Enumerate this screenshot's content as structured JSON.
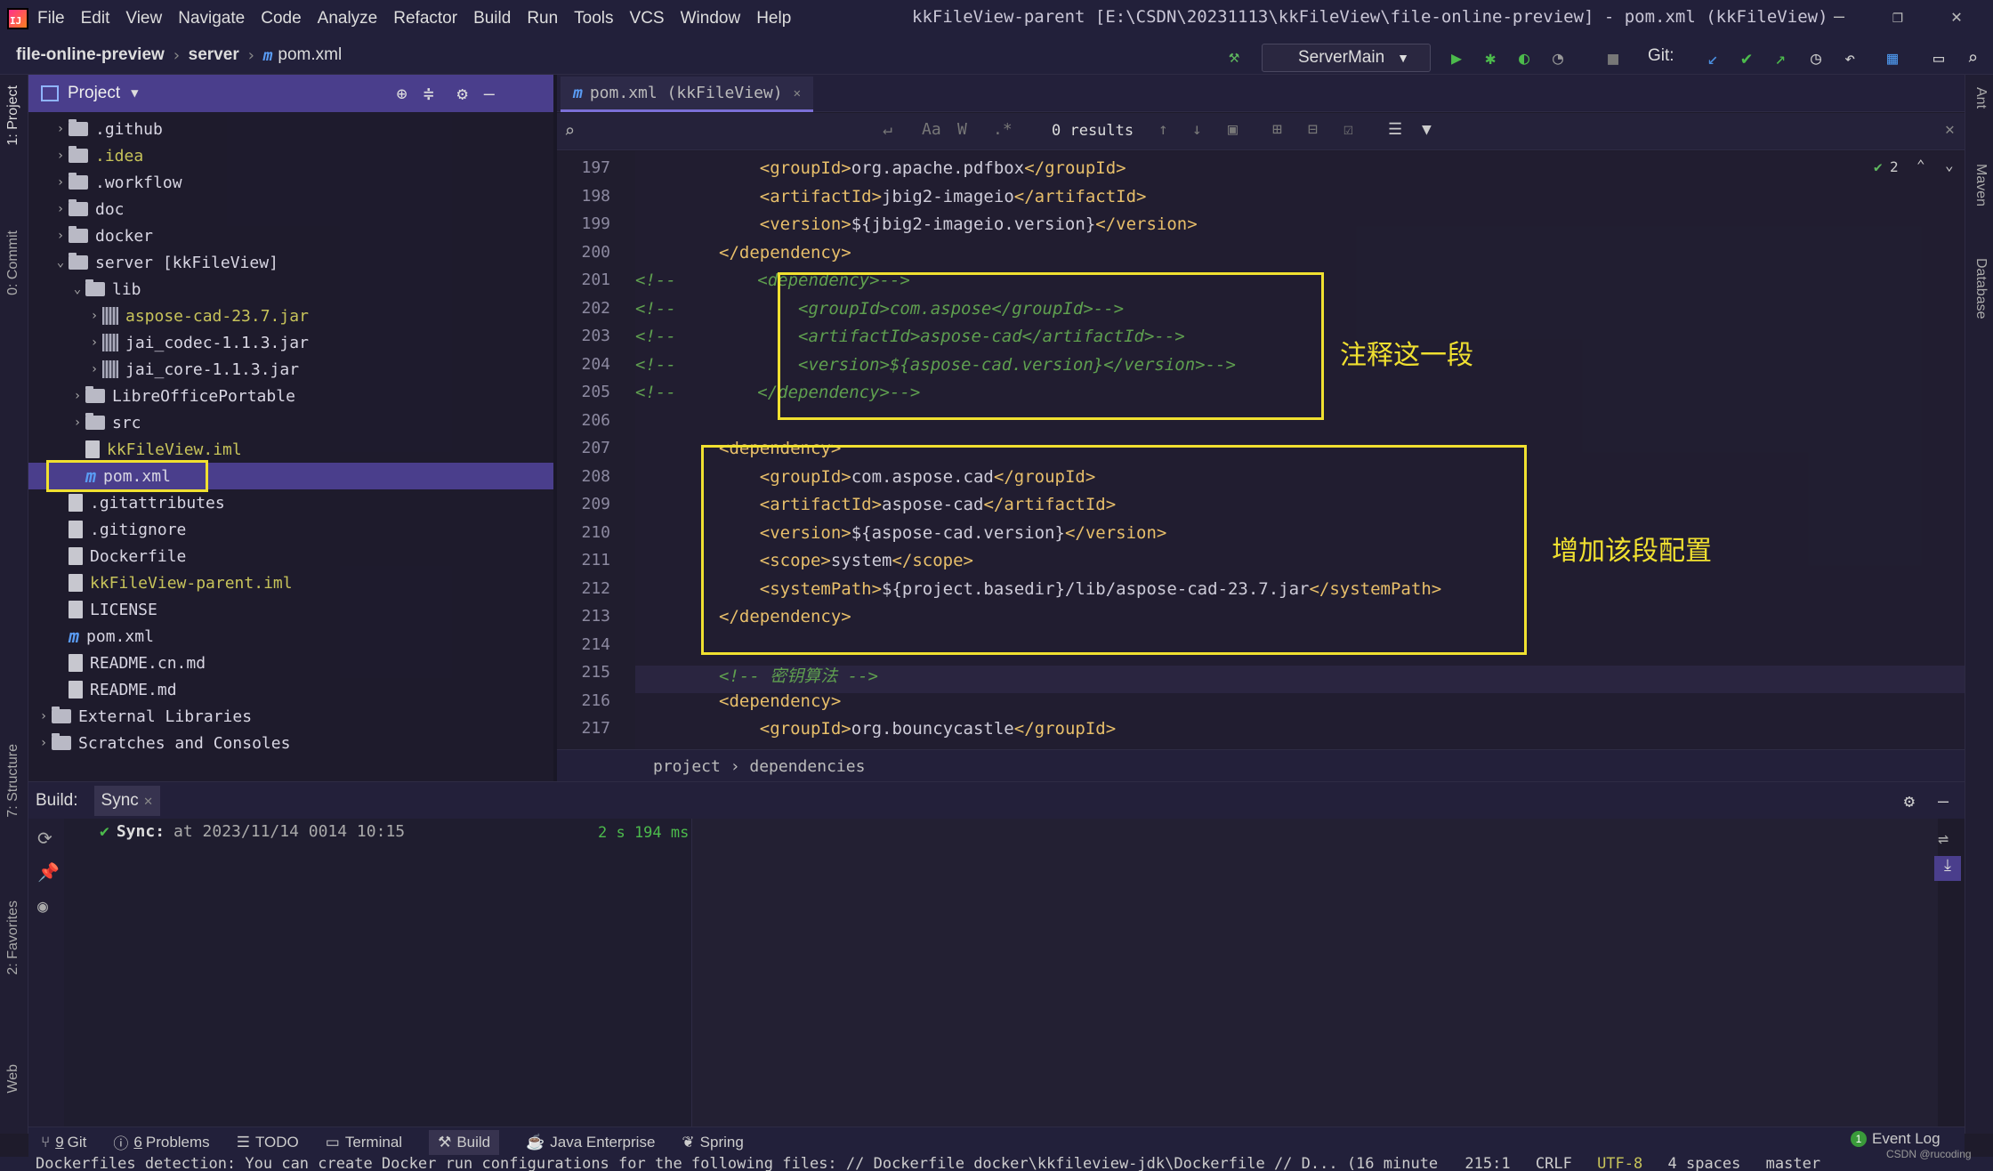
{
  "app": {
    "title": "kkFileView-parent [E:\\CSDN\\20231113\\kkFileView\\file-online-preview] - pom.xml (kkFileView)"
  },
  "menu": [
    "File",
    "Edit",
    "View",
    "Navigate",
    "Code",
    "Analyze",
    "Refactor",
    "Build",
    "Run",
    "Tools",
    "VCS",
    "Window",
    "Help"
  ],
  "breadcrumb": {
    "root": "file-online-preview",
    "module": "server",
    "file": "pom.xml"
  },
  "run_config": "ServerMain",
  "git_label": "Git:",
  "project_panel": {
    "title": "Project"
  },
  "tree": [
    {
      "name": ".github",
      "type": "folder",
      "depth": 1,
      "arrow": "›"
    },
    {
      "name": ".idea",
      "type": "folder",
      "depth": 1,
      "arrow": "›",
      "excluded": true
    },
    {
      "name": ".workflow",
      "type": "folder",
      "depth": 1,
      "arrow": "›"
    },
    {
      "name": "doc",
      "type": "folder",
      "depth": 1,
      "arrow": "›"
    },
    {
      "name": "docker",
      "type": "folder",
      "depth": 1,
      "arrow": "›"
    },
    {
      "name": "server [kkFileView]",
      "type": "folder",
      "depth": 1,
      "arrow": "⌄"
    },
    {
      "name": "lib",
      "type": "folder",
      "depth": 2,
      "arrow": "⌄"
    },
    {
      "name": "aspose-cad-23.7.jar",
      "type": "jar",
      "depth": 3,
      "arrow": "›",
      "excluded": true
    },
    {
      "name": "jai_codec-1.1.3.jar",
      "type": "jar",
      "depth": 3,
      "arrow": "›"
    },
    {
      "name": "jai_core-1.1.3.jar",
      "type": "jar",
      "depth": 3,
      "arrow": "›"
    },
    {
      "name": "LibreOfficePortable",
      "type": "folder",
      "depth": 2,
      "arrow": "›"
    },
    {
      "name": "src",
      "type": "folder",
      "depth": 2,
      "arrow": "›"
    },
    {
      "name": "kkFileView.iml",
      "type": "file",
      "depth": 2,
      "arrow": "",
      "excluded": true
    },
    {
      "name": "pom.xml",
      "type": "maven",
      "depth": 2,
      "arrow": "",
      "selected": true
    },
    {
      "name": ".gitattributes",
      "type": "file",
      "depth": 1,
      "arrow": ""
    },
    {
      "name": ".gitignore",
      "type": "file",
      "depth": 1,
      "arrow": ""
    },
    {
      "name": "Dockerfile",
      "type": "file",
      "depth": 1,
      "arrow": ""
    },
    {
      "name": "kkFileView-parent.iml",
      "type": "file",
      "depth": 1,
      "arrow": "",
      "excluded": true
    },
    {
      "name": "LICENSE",
      "type": "file",
      "depth": 1,
      "arrow": ""
    },
    {
      "name": "pom.xml",
      "type": "maven",
      "depth": 1,
      "arrow": ""
    },
    {
      "name": "README.cn.md",
      "type": "file",
      "depth": 1,
      "arrow": ""
    },
    {
      "name": "README.md",
      "type": "file",
      "depth": 1,
      "arrow": ""
    },
    {
      "name": "External Libraries",
      "type": "lib",
      "depth": 0,
      "arrow": "›"
    },
    {
      "name": "Scratches and Consoles",
      "type": "scratch",
      "depth": 0,
      "arrow": "›"
    }
  ],
  "editor_tab": "pom.xml (kkFileView)",
  "search": {
    "results": "0 results"
  },
  "inspection_count": "2",
  "code_lines": [
    {
      "n": "197",
      "text": "    <groupId>org.apache.pdfbox</groupId>",
      "kind": "xml"
    },
    {
      "n": "198",
      "text": "    <artifactId>jbig2-imageio</artifactId>",
      "kind": "xml"
    },
    {
      "n": "199",
      "text": "    <version>${jbig2-imageio.version}</version>",
      "kind": "xml"
    },
    {
      "n": "200",
      "text": "</dependency>",
      "kind": "xml"
    },
    {
      "n": "201",
      "text": "<!--        <dependency>-->",
      "kind": "comment"
    },
    {
      "n": "202",
      "text": "<!--            <groupId>com.aspose</groupId>-->",
      "kind": "comment"
    },
    {
      "n": "203",
      "text": "<!--            <artifactId>aspose-cad</artifactId>-->",
      "kind": "comment"
    },
    {
      "n": "204",
      "text": "<!--            <version>${aspose-cad.version}</version>-->",
      "kind": "comment"
    },
    {
      "n": "205",
      "text": "<!--        </dependency>-->",
      "kind": "comment"
    },
    {
      "n": "206",
      "text": "",
      "kind": "xml"
    },
    {
      "n": "207",
      "text": "<dependency>",
      "kind": "xml"
    },
    {
      "n": "208",
      "text": "    <groupId>com.aspose.cad</groupId>",
      "kind": "xml"
    },
    {
      "n": "209",
      "text": "    <artifactId>aspose-cad</artifactId>",
      "kind": "xml"
    },
    {
      "n": "210",
      "text": "    <version>${aspose-cad.version}</version>",
      "kind": "xml"
    },
    {
      "n": "211",
      "text": "    <scope>system</scope>",
      "kind": "xml"
    },
    {
      "n": "212",
      "text": "    <systemPath>${project.basedir}/lib/aspose-cad-23.7.jar</systemPath>",
      "kind": "xml"
    },
    {
      "n": "213",
      "text": "</dependency>",
      "kind": "xml"
    },
    {
      "n": "214",
      "text": "",
      "kind": "xml"
    },
    {
      "n": "215",
      "text": "<!-- 密钥算法 -->",
      "kind": "comment"
    },
    {
      "n": "216",
      "text": "<dependency>",
      "kind": "xml"
    },
    {
      "n": "217",
      "text": "    <groupId>org.bouncycastle</groupId>",
      "kind": "xml"
    }
  ],
  "annotations": {
    "comment_note": "注释这一段",
    "add_note": "增加该段配置"
  },
  "editor_breadcrumb": "project › dependencies",
  "build": {
    "label": "Build:",
    "tab": "Sync",
    "sync_label": "Sync:",
    "sync_text": "at 2023/11/14 0014 10:15",
    "duration": "2 s 194 ms"
  },
  "bottom_tools": [
    {
      "num": "9",
      "label": "Git"
    },
    {
      "num": "6",
      "label": "Problems"
    },
    {
      "num": "",
      "label": "TODO"
    },
    {
      "num": "",
      "label": "Terminal"
    },
    {
      "num": "",
      "label": "Build"
    },
    {
      "num": "",
      "label": "Java Enterprise"
    },
    {
      "num": "",
      "label": "Spring"
    }
  ],
  "event_log": {
    "count": "1",
    "label": "Event Log"
  },
  "status_message": "Dockerfiles detection: You can create Docker run configurations for the following files: // Dockerfile docker\\kkfileview-jdk\\Dockerfile // D...  (16 minute",
  "status_right": {
    "position": "215:1",
    "line_sep": "CRLF",
    "encoding": "UTF-8",
    "indent": "4 spaces",
    "branch": "master"
  },
  "watermark": "CSDN @rucoding",
  "side_tools_left": [
    "1: Project",
    "0: Commit",
    "7: Structure",
    "2: Favorites",
    "Web"
  ],
  "side_tools_right": [
    "Ant",
    "Maven",
    "Database"
  ],
  "colors": {
    "accent": "#4a3e8c",
    "annotation": "#f0e030",
    "xml_tag": "#e8bf6a",
    "comment": "#5f9f4f"
  }
}
